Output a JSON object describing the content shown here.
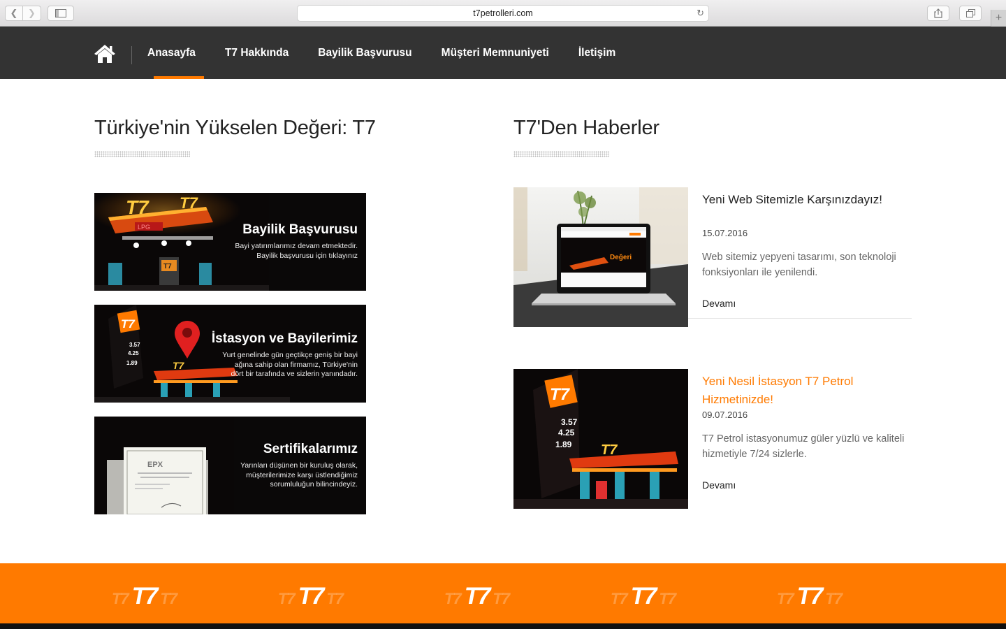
{
  "browser": {
    "url": "t7petrolleri.com"
  },
  "nav": {
    "items": [
      {
        "label": "Anasayfa",
        "active": true
      },
      {
        "label": "T7 Hakkında",
        "active": false
      },
      {
        "label": "Bayilik Başvurusu",
        "active": false
      },
      {
        "label": "Müşteri Memnuniyeti",
        "active": false
      },
      {
        "label": "İletişim",
        "active": false
      }
    ],
    "accent_color": "#ff7a00",
    "background": "#333333"
  },
  "left": {
    "title": "Türkiye'nin Yükselen Değeri: T7",
    "banners": [
      {
        "title": "Bayilik Başvurusu",
        "desc": [
          "Bayi yatırımlarımız devam etmektedir.",
          "Bayilik başvurusu için tıklayınız"
        ]
      },
      {
        "title": "İstasyon ve Bayilerimiz",
        "desc": [
          "Yurt genelinde gün geçtikçe geniş bir bayi",
          "ağına sahip olan firmamız, Türkiye'nin",
          "dört bir tarafında ve sizlerin yanındadır."
        ]
      },
      {
        "title": "Sertifikalarımız",
        "desc": [
          "Yarınları düşünen bir kuruluş olarak,",
          "müşterilerimize karşı üstlendiğimiz",
          "sorumluluğun bilincindeyiz."
        ]
      }
    ]
  },
  "right": {
    "title": "T7'Den Haberler",
    "news": [
      {
        "title": "Yeni Web Sitemizle Karşınızdayız!",
        "date": "15.07.2016",
        "desc": "Web sitemiz yepyeni tasarımı, son teknoloji fonksiyonları ile yenilendi.",
        "more": "Devamı"
      },
      {
        "title": "Yeni Nesil İstasyon T7 Petrol Hizmetinizde!",
        "date": "09.07.2016",
        "desc": "T7 Petrol istasyonumuz güler yüzlü ve kaliteli hizmetiyle 7/24 sizlerle.",
        "more": "Devamı"
      }
    ]
  },
  "images": {
    "laptop_screen_word": "Değeri",
    "price_sign": [
      "3.57",
      "4.25",
      "1.89"
    ],
    "canopy_logo": "T7",
    "lpg_sign": "LPG",
    "certificate_logo": "EPX"
  },
  "footer": {
    "logo_big": "T7",
    "logo_small": "T7",
    "logo_count": 5,
    "background": "#ff7a00"
  }
}
